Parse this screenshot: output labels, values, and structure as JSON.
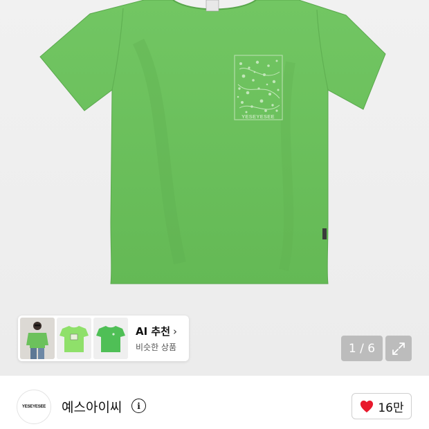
{
  "gallery": {
    "page_indicator": "1 / 6",
    "expand_icon": "expand-arrows-icon",
    "print_text": "YESEYESEE"
  },
  "ai_recommend": {
    "title": "AI 추천",
    "subtitle": "비슷한 상품",
    "chevron": "›"
  },
  "brand": {
    "logo_text": "YESEYESEE",
    "name": "예스아이씨",
    "info_icon": "i"
  },
  "like": {
    "count": "16만",
    "icon": "heart-icon",
    "color": "#e8192c"
  },
  "colors": {
    "shirt": "#6cc15c",
    "print": "#b8e0ae"
  }
}
